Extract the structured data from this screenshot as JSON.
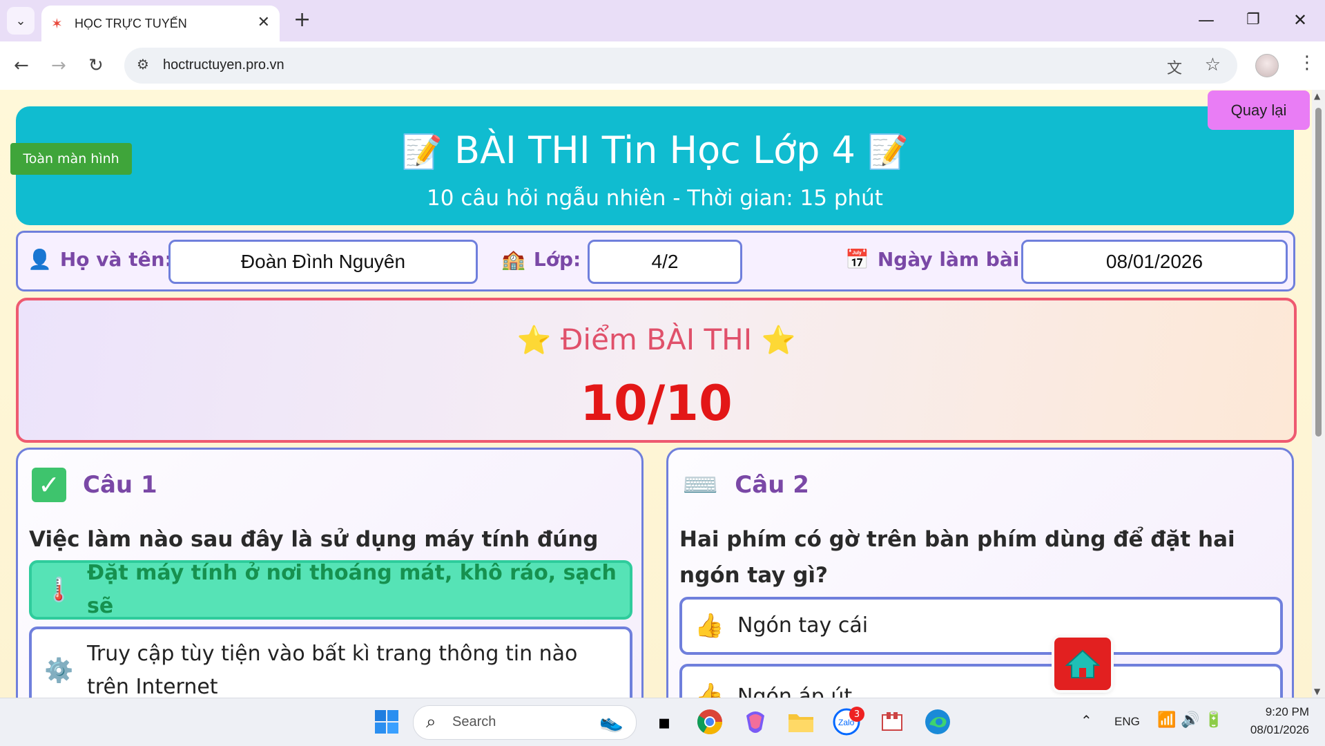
{
  "browser": {
    "tab_title": "HỌC TRỰC TUYẾN",
    "url": "hoctructuyen.pro.vn"
  },
  "page": {
    "header": {
      "title": "BÀI THI Tin Học Lớp 4",
      "subtitle": "10 câu hỏi ngẫu nhiên - Thời gian: 15 phút",
      "fullscreen_label": "Toàn màn hình",
      "back_label": "Quay lại"
    },
    "info": {
      "name_label": "Họ và tên:",
      "name_value": "Đoàn Đình Nguyên",
      "class_label": "Lớp:",
      "class_value": "4/2",
      "date_label": "Ngày làm bài:",
      "date_value": "08/01/2026"
    },
    "score": {
      "title": "Điểm BÀI THI",
      "value": "10/10"
    },
    "questions": [
      {
        "label": "Câu 1",
        "status": "correct",
        "text": "Việc làm nào sau đây là sử dụng máy tính đúng cách?",
        "options": [
          {
            "icon": "thermometer-icon",
            "text": "Đặt máy tính ở nơi thoáng mát, khô ráo, sạch sẽ",
            "selected": true
          },
          {
            "icon": "gear-icon",
            "text": "Truy cập tùy tiện vào bất kì trang thông tin nào trên Internet",
            "selected": false
          }
        ]
      },
      {
        "label": "Câu 2",
        "status": "keyboard",
        "text": "Hai phím có gờ trên bàn phím dùng để đặt hai ngón tay gì?",
        "options": [
          {
            "icon": "thumbs-up-icon",
            "text": "Ngón tay cái",
            "selected": false
          },
          {
            "icon": "thumbs-up-icon",
            "text": "Ngón áp út",
            "selected": false
          }
        ]
      }
    ]
  },
  "taskbar": {
    "search_placeholder": "Search",
    "zalo_badge": "3",
    "language": "ENG",
    "time": "9:20 PM",
    "date": "08/01/2026"
  }
}
